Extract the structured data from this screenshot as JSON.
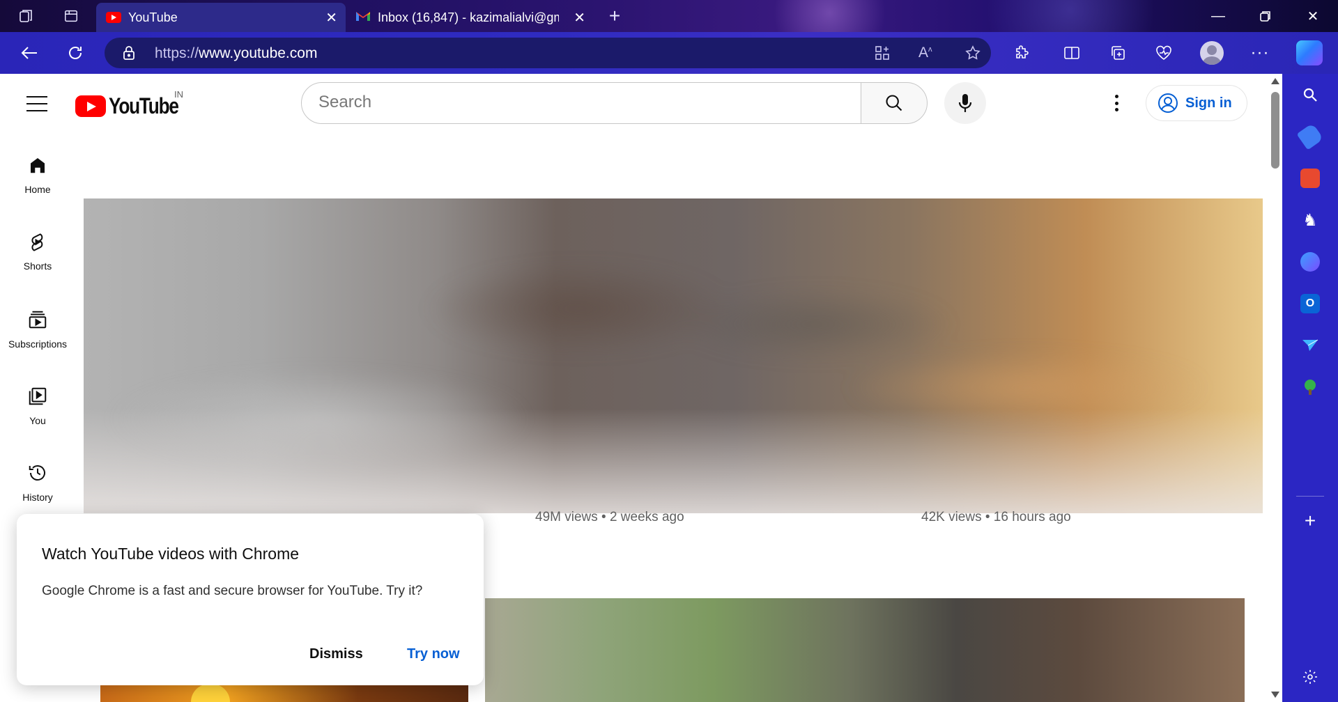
{
  "browser": {
    "tabs": [
      {
        "title": "YouTube",
        "active": true,
        "favicon": "youtube-icon"
      },
      {
        "title": "Inbox (16,847) - kazimalialvi@gm",
        "active": false,
        "favicon": "gmail-icon"
      }
    ],
    "url_prefix": "https://",
    "url_domain": "www.youtube.com",
    "accent_color": "#2b26c3"
  },
  "youtube": {
    "country_code": "IN",
    "search_placeholder": "Search",
    "sign_in_label": "Sign in",
    "guide": [
      {
        "label": "Home",
        "icon": "home-icon"
      },
      {
        "label": "Shorts",
        "icon": "shorts-icon"
      },
      {
        "label": "Subscriptions",
        "icon": "subscriptions-icon"
      },
      {
        "label": "You",
        "icon": "you-icon"
      },
      {
        "label": "History",
        "icon": "history-icon"
      }
    ],
    "videos": [
      {
        "meta": "49M views • 2 weeks ago"
      },
      {
        "meta": "42K views • 16 hours ago"
      }
    ]
  },
  "popup": {
    "title": "Watch YouTube videos with Chrome",
    "body": "Google Chrome is a fast and secure browser for YouTube. Try it?",
    "dismiss_label": "Dismiss",
    "try_label": "Try now"
  }
}
